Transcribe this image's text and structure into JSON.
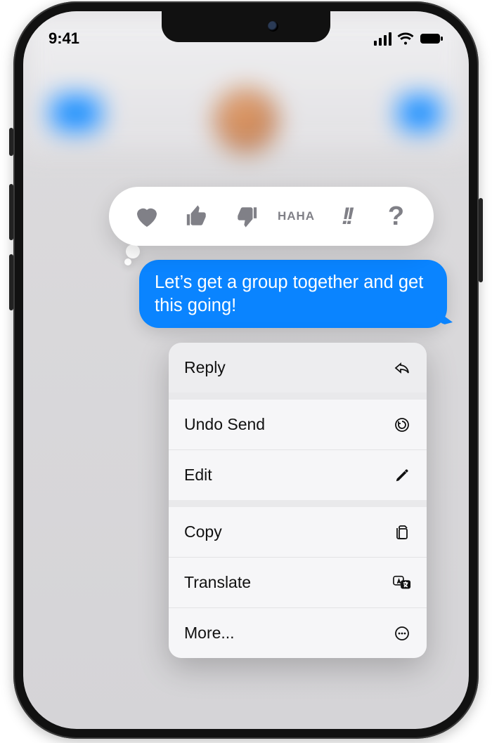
{
  "status": {
    "time": "9:41"
  },
  "tapback": {
    "heart": "heart",
    "thumbs_up": "thumbs-up",
    "thumbs_down": "thumbs-down",
    "haha_top": "HA",
    "haha_bot": "HA",
    "emphasize": "!!",
    "question": "?"
  },
  "message": {
    "text": "Let’s get a group together and get this going!"
  },
  "menu": {
    "reply": "Reply",
    "undo_send": "Undo Send",
    "edit": "Edit",
    "copy": "Copy",
    "translate": "Translate",
    "more": "More..."
  }
}
